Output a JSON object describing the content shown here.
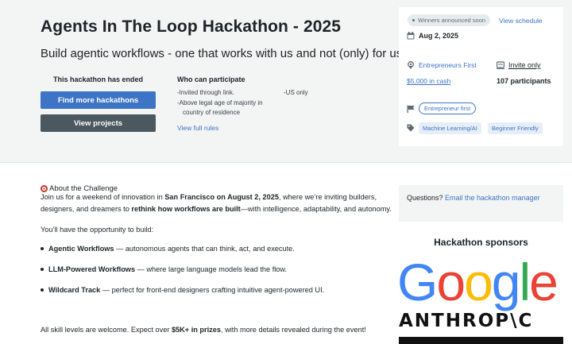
{
  "hero": {
    "title": "Agents In The Loop Hackathon - 2025",
    "tagline": "Build agentic workflows - one that works with us and not (only) for us!",
    "status": "This hackathon has ended",
    "find_button": "Find more hackathons",
    "view_button": "View projects",
    "who": {
      "title": "Who can participate",
      "items": [
        "Invited through link.",
        "Above legal age of majority in",
        "country of residence",
        "US only"
      ],
      "rules_link": "View full rules"
    }
  },
  "card": {
    "badge": "Winners announced soon",
    "schedule_link": "View schedule",
    "date": "Aug 2, 2025",
    "host_link": "Entrepreneurs First",
    "visibility": "Invite only",
    "prize_link": "$5,000 in cash",
    "participants": "107 participants",
    "category": "Entrepreneur first",
    "tags": [
      "Machine Learning/AI",
      "Beginner Friendly"
    ]
  },
  "about": {
    "title": "About the Challenge",
    "intro_1a": "Join us for a weekend of innovation in ",
    "intro_1b": "San Francisco on August 2, 2025",
    "intro_1c": ", where we’re inviting builders,",
    "intro_2a": "designers, and dreamers to ",
    "intro_2b": "rethink how workflows are built",
    "intro_2c": "—with intelligence, adaptability, and autonomy.",
    "opportunity": "You’ll have the opportunity to build:",
    "tracks": [
      {
        "name": "Agentic Workflows",
        "desc": " — autonomous agents that can think, act, and execute."
      },
      {
        "name": "LLM-Powered Workflows",
        "desc": " — where large language models lead the flow."
      },
      {
        "name": "Wildcard Track",
        "desc": " — perfect for front-end designers crafting intuitive agent-powered UI."
      }
    ],
    "closing_a": "All skill levels are welcome. Expect over ",
    "closing_b": "$5K+ in prizes",
    "closing_c": ", with more details revealed during the event!"
  },
  "sidebar": {
    "questions_label": "Questions? ",
    "questions_link": "Email the hackathon manager",
    "sponsors_title": "Hackathon sponsors",
    "google_letters": [
      "G",
      "o",
      "o",
      "g",
      "l",
      "e"
    ],
    "anthropic": "ANTHROP\\C"
  },
  "colors": {
    "accent": "#3d74c5",
    "google_blue": "#4285F4",
    "google_red": "#EA4335",
    "google_yellow": "#FBBC05",
    "google_green": "#34A853"
  }
}
